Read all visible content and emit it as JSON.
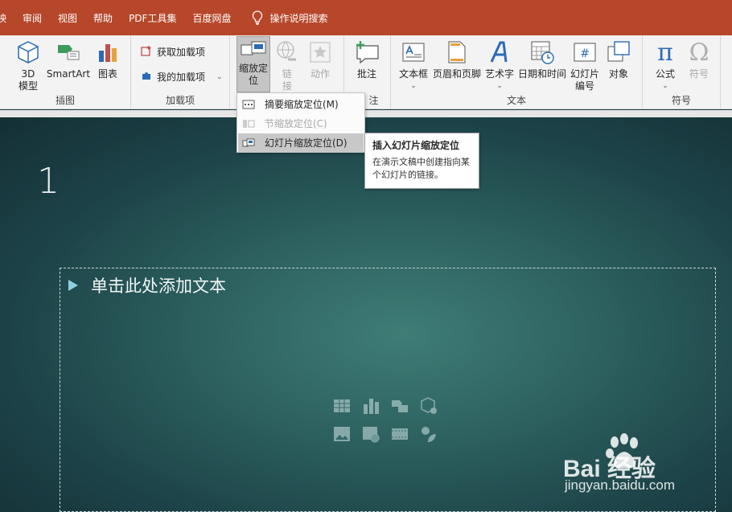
{
  "menubar": {
    "tabs": [
      "映",
      "审阅",
      "视图",
      "帮助",
      "PDF工具集",
      "百度网盘"
    ],
    "search_label": "操作说明搜索"
  },
  "ribbon": {
    "illustrations": {
      "label": "插图",
      "model3d": "3D\n模型",
      "smartart": "SmartArt",
      "chart": "图表"
    },
    "addins": {
      "label": "加载项",
      "get": "获取加载项",
      "mine": "我的加载项"
    },
    "links": {
      "zoom": "缩放定位",
      "link": "链接",
      "action": "动作"
    },
    "comments": {
      "label_partial": "注",
      "comment": "批注"
    },
    "text": {
      "label": "文本",
      "textbox": "文本框",
      "header_footer": "页眉和页脚",
      "wordart": "艺术字",
      "datetime": "日期和时间",
      "slide_number": "幻灯片编号",
      "object": "对象"
    },
    "symbols": {
      "label": "符号",
      "equation": "公式",
      "symbol": "符号"
    }
  },
  "dropdown": {
    "items": [
      {
        "label": "摘要缩放定位(M)"
      },
      {
        "label": "节缩放定位(C)"
      },
      {
        "label": "幻灯片缩放定位(D)"
      }
    ]
  },
  "tooltip": {
    "title": "插入幻灯片缩放定位",
    "description": "在演示文稿中创建指向某个幻灯片的链接。"
  },
  "slide": {
    "number": "1",
    "placeholder_text": "单击此处添加文本"
  },
  "watermark": {
    "brand": "Bai 经验",
    "url": "jingyan.baidu.com"
  }
}
